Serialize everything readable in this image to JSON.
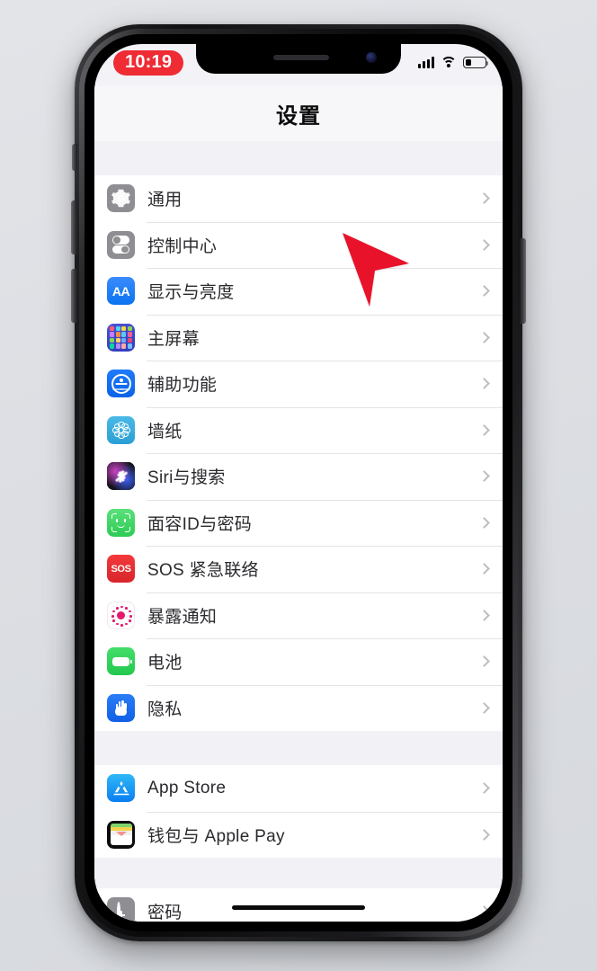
{
  "device": {
    "platform": "iOS",
    "buttons": {
      "mute_switch": "Mute switch",
      "volume_up": "Volume up",
      "volume_down": "Volume down",
      "power": "Side button"
    }
  },
  "status_bar": {
    "time": "10:19",
    "time_badge_color": "#ef2b34",
    "cellular_icon": "signal-bars-icon",
    "cellular_bars": 4,
    "wifi_icon": "wifi-icon",
    "battery_icon": "battery-icon",
    "battery_level_percent": 33
  },
  "nav": {
    "title": "设置"
  },
  "sections": [
    {
      "id": "system",
      "items": [
        {
          "label": "通用",
          "icon": "gear-icon",
          "icon_color": "#8e8e93",
          "chevron": "chevron-right-icon"
        },
        {
          "label": "控制中心",
          "icon": "toggles-icon",
          "icon_color": "#8e8e93",
          "chevron": "chevron-right-icon"
        },
        {
          "label": "显示与亮度",
          "icon": "display-aa-icon",
          "icon_color": "#0a74f0",
          "chevron": "chevron-right-icon"
        },
        {
          "label": "主屏幕",
          "icon": "home-screen-grid-icon",
          "icon_color": "#3b45c6",
          "chevron": "chevron-right-icon"
        },
        {
          "label": "辅助功能",
          "icon": "accessibility-icon",
          "icon_color": "#0a63e8",
          "chevron": "chevron-right-icon"
        },
        {
          "label": "墙纸",
          "icon": "wallpaper-flower-icon",
          "icon_color": "#2b9fd4",
          "chevron": "chevron-right-icon"
        },
        {
          "label": "Siri与搜索",
          "icon": "siri-orb-icon",
          "icon_color": "#101014",
          "chevron": "chevron-right-icon"
        },
        {
          "label": "面容ID与密码",
          "icon": "face-id-icon",
          "icon_color": "#2ecb55",
          "chevron": "chevron-right-icon"
        },
        {
          "label": "SOS 紧急联络",
          "icon": "sos-icon",
          "icon_color": "#d8252b",
          "chevron": "chevron-right-icon"
        },
        {
          "label": "暴露通知",
          "icon": "exposure-notification-icon",
          "icon_color": "#e6186f",
          "chevron": "chevron-right-icon"
        },
        {
          "label": "电池",
          "icon": "battery-green-icon",
          "icon_color": "#22c94d",
          "chevron": "chevron-right-icon"
        },
        {
          "label": "隐私",
          "icon": "privacy-hand-icon",
          "icon_color": "#1160e6",
          "chevron": "chevron-right-icon"
        }
      ]
    },
    {
      "id": "store",
      "items": [
        {
          "label": "App Store",
          "icon": "app-store-icon",
          "icon_color": "#0a7ef0",
          "chevron": "chevron-right-icon"
        },
        {
          "label": "钱包与 Apple Pay",
          "icon": "wallet-icon",
          "icon_color": "#0c0c0e",
          "chevron": "chevron-right-icon"
        }
      ]
    },
    {
      "id": "accounts",
      "items": [
        {
          "label": "密码",
          "icon": "passwords-key-icon",
          "icon_color": "#8e8e93",
          "chevron": "chevron-right-icon"
        }
      ]
    }
  ],
  "overlays": {
    "cursor": {
      "name": "red-arrow-cursor",
      "color": "#e8122a",
      "points_at": "通用"
    },
    "touch_indicator": {
      "name": "touch-press-indicator",
      "color": "#b7b7bc",
      "near": "隐私"
    },
    "home_indicator": {
      "name": "home-indicator",
      "color": "#0a0a0b"
    }
  }
}
